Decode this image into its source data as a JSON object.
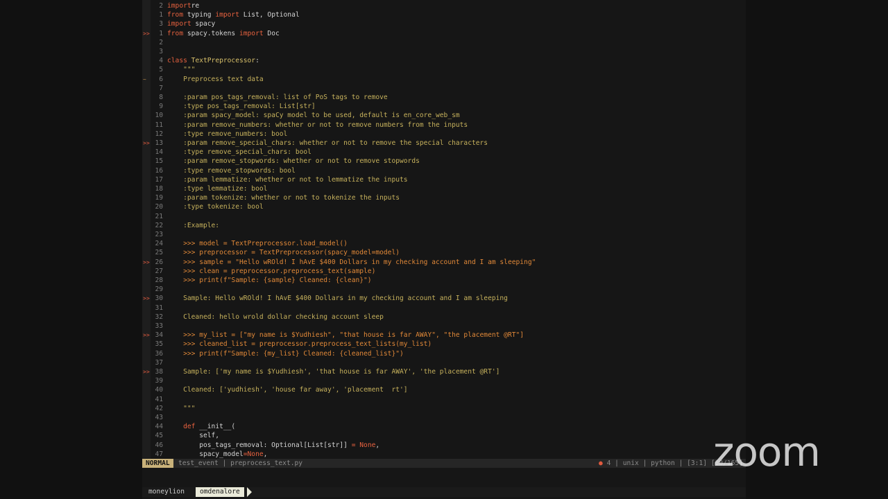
{
  "editor": {
    "lines": [
      {
        "sign": "",
        "num": "2",
        "segs": [
          [
            "kw",
            "import"
          ],
          [
            "",
            "re"
          ]
        ]
      },
      {
        "sign": "",
        "num": "1",
        "segs": [
          [
            "kw",
            "from"
          ],
          [
            "",
            " typing "
          ],
          [
            "kw",
            "import"
          ],
          [
            "",
            " List, Optional"
          ]
        ]
      },
      {
        "sign": "",
        "num": "3",
        "segs": [
          [
            "kw",
            "import"
          ],
          [
            "",
            " spacy"
          ]
        ]
      },
      {
        "sign": ">>",
        "num": "1",
        "segs": [
          [
            "kw",
            "from"
          ],
          [
            "",
            " spacy.tokens "
          ],
          [
            "kw",
            "import"
          ],
          [
            "",
            " Doc"
          ]
        ]
      },
      {
        "sign": "",
        "num": "2",
        "segs": []
      },
      {
        "sign": "",
        "num": "3",
        "segs": []
      },
      {
        "sign": "",
        "num": "4",
        "segs": [
          [
            "kw",
            "class"
          ],
          [
            "cls",
            " TextPreprocessor"
          ],
          [
            "",
            ":"
          ]
        ]
      },
      {
        "sign": "",
        "num": "5",
        "segs": [
          [
            "doc",
            "    \"\"\""
          ]
        ]
      },
      {
        "sign": "~",
        "num": "6",
        "segs": [
          [
            "doc",
            "    Preprocess text data"
          ]
        ]
      },
      {
        "sign": "",
        "num": "7",
        "segs": []
      },
      {
        "sign": "",
        "num": "8",
        "segs": [
          [
            "doc",
            "    :param pos_tags_removal: list of PoS tags to remove"
          ]
        ]
      },
      {
        "sign": "",
        "num": "9",
        "segs": [
          [
            "doc",
            "    :type pos_tags_removal: List[str]"
          ]
        ]
      },
      {
        "sign": "",
        "num": "10",
        "segs": [
          [
            "doc",
            "    :param spacy_model: spaCy model to be used, default is en_core_web_sm"
          ]
        ]
      },
      {
        "sign": "",
        "num": "11",
        "segs": [
          [
            "doc",
            "    :param remove_numbers: whether or not to remove numbers from the inputs"
          ]
        ]
      },
      {
        "sign": "",
        "num": "12",
        "segs": [
          [
            "doc",
            "    :type remove_numbers: bool"
          ]
        ]
      },
      {
        "sign": ">>",
        "num": "13",
        "segs": [
          [
            "doc",
            "    :param remove_special_chars: whether or not to remove the special characters"
          ]
        ]
      },
      {
        "sign": "",
        "num": "14",
        "segs": [
          [
            "doc",
            "    :type remove_special_chars: bool"
          ]
        ]
      },
      {
        "sign": "",
        "num": "15",
        "segs": [
          [
            "doc",
            "    :param remove_stopwords: whether or not to remove stopwords"
          ]
        ]
      },
      {
        "sign": "",
        "num": "16",
        "segs": [
          [
            "doc",
            "    :type remove_stopwords: bool"
          ]
        ]
      },
      {
        "sign": "",
        "num": "17",
        "segs": [
          [
            "doc",
            "    :param lemmatize: whether or not to lemmatize the inputs"
          ]
        ]
      },
      {
        "sign": "",
        "num": "18",
        "segs": [
          [
            "doc",
            "    :type lemmatize: bool"
          ]
        ]
      },
      {
        "sign": "",
        "num": "19",
        "segs": [
          [
            "doc",
            "    :param tokenize: whether or not to tokenize the inputs"
          ]
        ]
      },
      {
        "sign": "",
        "num": "20",
        "segs": [
          [
            "doc",
            "    :type tokenize: bool"
          ]
        ]
      },
      {
        "sign": "",
        "num": "21",
        "segs": []
      },
      {
        "sign": "",
        "num": "22",
        "segs": [
          [
            "doc",
            "    :Example:"
          ]
        ]
      },
      {
        "sign": "",
        "num": "23",
        "segs": []
      },
      {
        "sign": "",
        "num": "24",
        "segs": [
          [
            "dt",
            "    >>> model = TextPreprocessor.load_model()"
          ]
        ]
      },
      {
        "sign": "",
        "num": "25",
        "segs": [
          [
            "dt",
            "    >>> preprocessor = TextPreprocessor(spacy_model=model)"
          ]
        ]
      },
      {
        "sign": ">>",
        "num": "26",
        "segs": [
          [
            "dt",
            "    >>> sample = \"Hello wROld! I hAvE $400 Dollars in my checking account and I am sleeping\""
          ]
        ]
      },
      {
        "sign": "",
        "num": "27",
        "segs": [
          [
            "dt",
            "    >>> clean = preprocessor.preprocess_text(sample)"
          ]
        ]
      },
      {
        "sign": "",
        "num": "28",
        "segs": [
          [
            "dt",
            "    >>> print(f\"Sample: {sample} Cleaned: {clean}\")"
          ]
        ]
      },
      {
        "sign": "",
        "num": "29",
        "segs": []
      },
      {
        "sign": ">>",
        "num": "30",
        "segs": [
          [
            "doc",
            "    Sample: Hello wROld! I hAvE $400 Dollars in my checking account and I am sleeping"
          ]
        ]
      },
      {
        "sign": "",
        "num": "31",
        "segs": []
      },
      {
        "sign": "",
        "num": "32",
        "segs": [
          [
            "doc",
            "    Cleaned: hello wrold dollar checking account sleep"
          ]
        ]
      },
      {
        "sign": "",
        "num": "33",
        "segs": []
      },
      {
        "sign": ">>",
        "num": "34",
        "segs": [
          [
            "dt",
            "    >>> my_list = [\"my name is $Yudhiesh\", \"that house is far AWAY\", \"the placement @RT\"]"
          ]
        ]
      },
      {
        "sign": "",
        "num": "35",
        "segs": [
          [
            "dt",
            "    >>> cleaned_list = preprocessor.preprocess_text_lists(my_list)"
          ]
        ]
      },
      {
        "sign": "",
        "num": "36",
        "segs": [
          [
            "dt",
            "    >>> print(f\"Sample: {my_list} Cleaned: {cleaned_list}\")"
          ]
        ]
      },
      {
        "sign": "",
        "num": "37",
        "segs": []
      },
      {
        "sign": ">>",
        "num": "38",
        "segs": [
          [
            "doc",
            "    Sample: ['my name is $Yudhiesh', 'that house is far AWAY', 'the placement @RT']"
          ]
        ]
      },
      {
        "sign": "",
        "num": "39",
        "segs": []
      },
      {
        "sign": "",
        "num": "40",
        "segs": [
          [
            "doc",
            "    Cleaned: ['yudhiesh', 'house far away', 'placement  rt']"
          ]
        ]
      },
      {
        "sign": "",
        "num": "41",
        "segs": []
      },
      {
        "sign": "",
        "num": "42",
        "segs": [
          [
            "doc",
            "    \"\"\""
          ]
        ]
      },
      {
        "sign": "",
        "num": "43",
        "segs": []
      },
      {
        "sign": "",
        "num": "44",
        "segs": [
          [
            "",
            "    "
          ],
          [
            "kw",
            "def"
          ],
          [
            "",
            " __init__("
          ]
        ]
      },
      {
        "sign": "",
        "num": "45",
        "segs": [
          [
            "",
            "        self,"
          ]
        ]
      },
      {
        "sign": "",
        "num": "46",
        "segs": [
          [
            "",
            "        pos_tags_removal: Optional[List[str]] "
          ],
          [
            "op",
            "="
          ],
          [
            "",
            " "
          ],
          [
            "none",
            "None"
          ],
          [
            "",
            ","
          ]
        ]
      },
      {
        "sign": "",
        "num": "47",
        "segs": [
          [
            "",
            "        spacy_model"
          ],
          [
            "op",
            "="
          ],
          [
            "none",
            "None"
          ],
          [
            "",
            ","
          ]
        ]
      }
    ]
  },
  "statusline": {
    "mode": "NORMAL",
    "file_info": "test_event | preprocess_text.py",
    "error_marker": "●",
    "right_info": " 4 | unix | python | [3:1] [00/165]"
  },
  "tmux": {
    "session": "moneylion",
    "window": "omdenalore"
  },
  "overlay": {
    "logo": "zoom"
  }
}
